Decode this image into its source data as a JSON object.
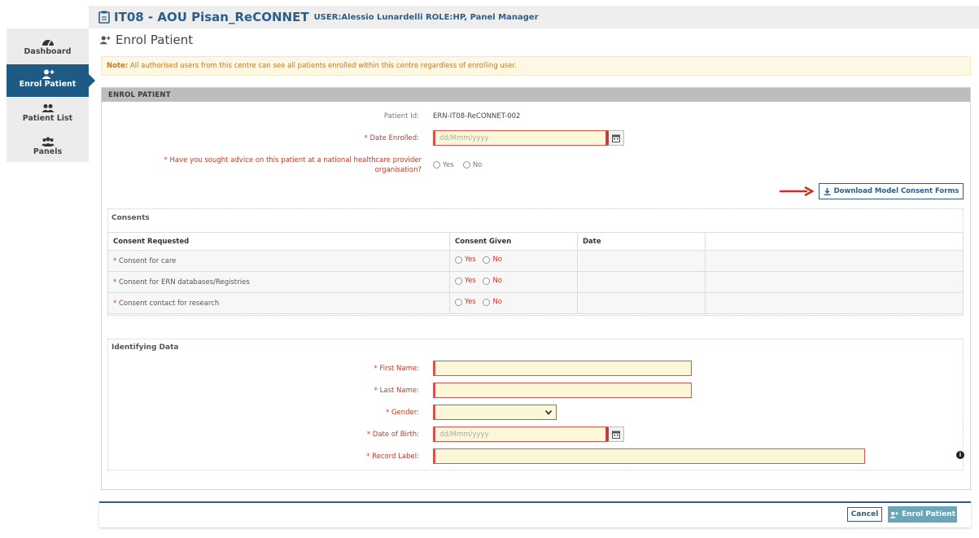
{
  "header": {
    "title": "IT08 - AOU Pisan_ReCONNET",
    "user_meta": "USER:Alessio Lunardelli ROLE:HP, Panel Manager"
  },
  "sidebar": {
    "items": [
      {
        "label": "Dashboard",
        "icon": "dashboard-icon"
      },
      {
        "label": "Enrol Patient",
        "icon": "user-plus-icon",
        "active": true
      },
      {
        "label": "Patient List",
        "icon": "users-icon"
      },
      {
        "label": "Panels",
        "icon": "group-icon"
      }
    ]
  },
  "page": {
    "title": "Enrol Patient",
    "note_bold": "Note:",
    "note_text": "All authorised users from this centre can see all patients enrolled within this centre regardless of enrolling user.",
    "panel_heading": "ENROL PATIENT"
  },
  "form": {
    "patient_id_label": "Patient Id:",
    "patient_id_value": "ERN-IT08-ReCONNET-002",
    "date_enrolled_label": "Date Enrolled:",
    "date_enrolled_placeholder": "dd/Mmm/yyyy",
    "advice_question": "Have you sought advice on this patient at a national healthcare provider organisation?",
    "yes": "Yes",
    "no": "No",
    "download_button": "Download Model Consent Forms"
  },
  "consents": {
    "section_title": "Consents",
    "columns": [
      "Consent Requested",
      "Consent Given",
      "Date"
    ],
    "rows": [
      {
        "label": "Consent for care"
      },
      {
        "label": "Consent for ERN databases/Registries"
      },
      {
        "label": "Consent contact for research"
      }
    ]
  },
  "identifying": {
    "section_title": "Identifying Data",
    "first_name_label": "First Name:",
    "last_name_label": "Last Name:",
    "gender_label": "Gender:",
    "dob_label": "Date of Birth:",
    "dob_placeholder": "dd/Mmm/yyyy",
    "record_label_label": "Record Label:"
  },
  "footer": {
    "cancel": "Cancel",
    "enrol": "Enrol Patient"
  },
  "colors": {
    "brand": "#2b5e8c",
    "sidebar_active": "#1d5a84",
    "required_border": "#d9534f",
    "field_bg": "#fbf7d8",
    "enrol_button": "#6aa6b8"
  }
}
